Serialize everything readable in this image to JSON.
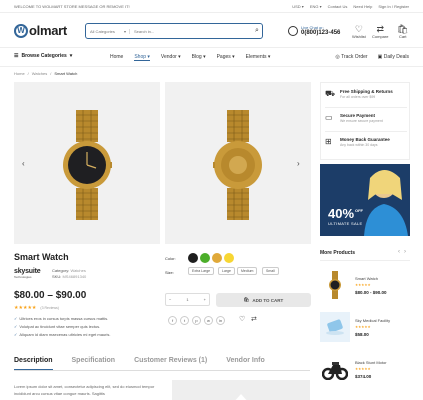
{
  "topbar": {
    "welcome": "WELCOME TO WOLMART STORE MESSAGE OR REMOVE IT!",
    "currency": "USD ▾",
    "language": "ENG ▾",
    "contact": "Contact Us",
    "need_help": "Need Help",
    "signin": "Sign In / Register"
  },
  "header": {
    "logo": "olmart",
    "logo_letter": "W",
    "search_category": "All Categories",
    "search_placeholder": "Search in...",
    "live_chat": "Live Chat or:",
    "phone": "0(800)123-456",
    "wishlist": "Wishlist",
    "compare": "Compare",
    "cart": "Cart"
  },
  "nav": {
    "browse": "Browse Categories",
    "items": [
      "Home",
      "Shop ▾",
      "Vendor ▾",
      "Blog ▾",
      "Pages ▾",
      "Elements ▾"
    ],
    "track_order": "Track Order",
    "daily_deals": "Daily Deals"
  },
  "breadcrumb": [
    "Home",
    "/",
    "Watches",
    "/",
    "Smart Watch"
  ],
  "product": {
    "title": "Smart Watch",
    "brand_name": "skysuite",
    "brand_sub": "Technologies",
    "category_label": "Category:",
    "category_value": "Watches",
    "sku_label": "SKU:",
    "sku_value": "MS46891340",
    "price": "$80.00 – $90.00",
    "stars": "★★★★★",
    "rating_fraction": 1.0,
    "reviews": "(3 Reviews)",
    "bullets": [
      "Ultrices eros in cursus turpis massa cursus mattis.",
      "Volutpat ac tincidunt vitae semper quis lectus.",
      "Aliquam id diam maecenas ultricies mi eget mauris."
    ],
    "color_label": "Color:",
    "colors": [
      "#1e1e1e",
      "#4cae2a",
      "#e0a93a",
      "#f7d633"
    ],
    "size_label": "Size:",
    "sizes": [
      "Extra Large",
      "Large",
      "Medium",
      "Small"
    ],
    "qty": "1",
    "add_to_cart": "ADD TO CART"
  },
  "tabs": [
    "Description",
    "Specification",
    "Customer Reviews (1)",
    "Vendor Info"
  ],
  "description": "Lorem ipsum dolor sit amet, consectetur adipiscing elit, sed do eiusmod tempor incididunt arcu cursus vitae congue mauris. Sagittis",
  "side_info": [
    {
      "title": "Free Shipping & Returns",
      "sub": "For all orders over $99"
    },
    {
      "title": "Secure Payment",
      "sub": "We ensure secure payment"
    },
    {
      "title": "Money Back Guarantee",
      "sub": "Any back within 30 days"
    }
  ],
  "banner": {
    "pct": "40%",
    "off": "OFF",
    "sale": "ULTIMATE SALE"
  },
  "more_products": {
    "title": "More Products",
    "items": [
      {
        "name": "Smart Watch",
        "stars": "★★★★★",
        "price": "$80.00 - $90.00"
      },
      {
        "name": "Sky Medical Facility",
        "stars": "★★★★★",
        "price": "$58.00"
      },
      {
        "name": "Black Stunt Motor",
        "stars": "★★★★★",
        "price": "$374.00"
      }
    ]
  },
  "colors_theme": {
    "accent": "#336699",
    "star": "#f9a31a"
  }
}
